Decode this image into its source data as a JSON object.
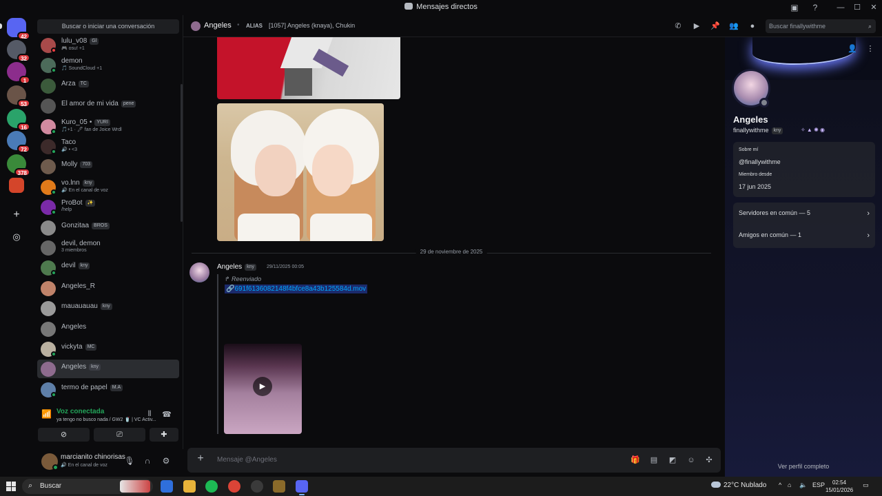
{
  "window": {
    "title": "Mensajes directos",
    "controls": [
      "—",
      "☐",
      "✕"
    ]
  },
  "servers": [
    {
      "name": "home",
      "color": "#5865f2",
      "badge": "42"
    },
    {
      "name": "s1",
      "color": "#555a66",
      "badge": "32"
    },
    {
      "name": "s2",
      "color": "#8c2d8c",
      "badge": "1"
    },
    {
      "name": "s3",
      "color": "#6a5448",
      "badge": "53"
    },
    {
      "name": "s4",
      "color": "#2aa36a",
      "badge": "16"
    },
    {
      "name": "s5",
      "color": "#4a7bb7",
      "badge": "72"
    },
    {
      "name": "s6",
      "color": "#3a8a3a",
      "badge": "378"
    },
    {
      "name": "s7",
      "color": "#d4452a",
      "badge": ""
    }
  ],
  "dm_search": {
    "label": "Buscar o iniciar una conversación"
  },
  "dms": [
    {
      "name": "lulu_v08",
      "tag": "Gl",
      "sub": "🎮 osu! +1",
      "avatar": "#a84a4a",
      "status": "#f23f43"
    },
    {
      "name": "demon",
      "tag": "",
      "sub": "🎵 SoundCloud +1",
      "avatar": "#4c6b5a",
      "status": "#23a55a"
    },
    {
      "name": "Arza",
      "tag": "TC",
      "sub": "",
      "avatar": "#3b5a3b",
      "status": ""
    },
    {
      "name": "El amor de mi vida",
      "tag": "pene",
      "sub": "",
      "avatar": "#555",
      "status": ""
    },
    {
      "name": "Kuro_05",
      "tag": "YURI",
      "sub": "🎵+1 · 🖊 fan de Joice Wrdl",
      "avatar": "#d28aa0",
      "status": "#23a55a",
      "dot": "•"
    },
    {
      "name": "Taco",
      "tag": "",
      "sub": "🔊 • <3",
      "avatar": "#3c2a2a",
      "status": "#23a55a"
    },
    {
      "name": "Molly",
      "tag": "703",
      "sub": "",
      "avatar": "#6e5b4d",
      "status": ""
    },
    {
      "name": "vo.lnn",
      "tag": "kny",
      "sub": "🔊 En el canal de voz",
      "avatar": "#e07a1a",
      "status": "#23a55a"
    },
    {
      "name": "ProBot",
      "tag": "✨",
      "sub": "/help",
      "avatar": "#7a2aa8",
      "status": "#23a55a"
    },
    {
      "name": "Gonzitaa",
      "tag": "BROS",
      "sub": "",
      "avatar": "#8a8a8a",
      "status": ""
    },
    {
      "name": "devil, demon",
      "tag": "",
      "sub": "3 miembros",
      "avatar": "#666",
      "status": ""
    },
    {
      "name": "devil",
      "tag": "kny",
      "sub": "",
      "avatar": "#4e7a4e",
      "status": "#23a55a"
    },
    {
      "name": "Angeles_R",
      "tag": "",
      "sub": "",
      "avatar": "#c0836a",
      "status": ""
    },
    {
      "name": "mauauauau",
      "tag": "kny",
      "sub": "",
      "avatar": "#9a9a9a",
      "status": ""
    },
    {
      "name": "Angeles",
      "tag": "",
      "sub": "",
      "avatar": "#777",
      "status": ""
    },
    {
      "name": "vickyta",
      "tag": "MC",
      "sub": "",
      "avatar": "#b9b0a0",
      "status": "#23a55a"
    },
    {
      "name": "Angeles",
      "tag": "kny",
      "sub": "",
      "avatar": "#8e6b8e",
      "status": "",
      "active": true
    },
    {
      "name": "termo de papel",
      "tag": "M.A",
      "sub": "",
      "avatar": "#5e7fa8",
      "status": "#23a55a"
    }
  ],
  "voice": {
    "title": "Voz conectada",
    "sub": "ya tengo no busco nada / GW2 🥤 | VC Activ..."
  },
  "user": {
    "name": "marcianito chinorisas",
    "status": "🔊 En el canal de voz"
  },
  "chat": {
    "name": "Angeles",
    "alias_label": "ALIAS",
    "members": "[1057] Angeles (knaya), Chukin",
    "search_placeholder": "Buscar finallywithme",
    "date_divider": "29 de noviembre de 2025",
    "message": {
      "author": "Angeles",
      "tag": "kny",
      "time": "29/11/2025 00:05",
      "forwarded": "Reenviado",
      "file": "691f6136082148f4bfce8a43b125584d.mov"
    },
    "composer_placeholder": "Mensaje @Angeles"
  },
  "profile": {
    "name": "Angeles",
    "username": "finallywithme",
    "tag": "kny",
    "about_label": "Sobre mí",
    "about_value": "@finallywithme",
    "member_since_label": "Miembro desde",
    "member_since_value": "17 jun 2025",
    "mutual_servers": "Servidores en común — 5",
    "mutual_friends": "Amigos en común — 1",
    "full_profile": "Ver perfil completo"
  },
  "taskbar": {
    "search": "Buscar",
    "weather": "22°C  Nublado",
    "lang": "ESP",
    "time": "02:54",
    "date": "15/01/2026"
  }
}
